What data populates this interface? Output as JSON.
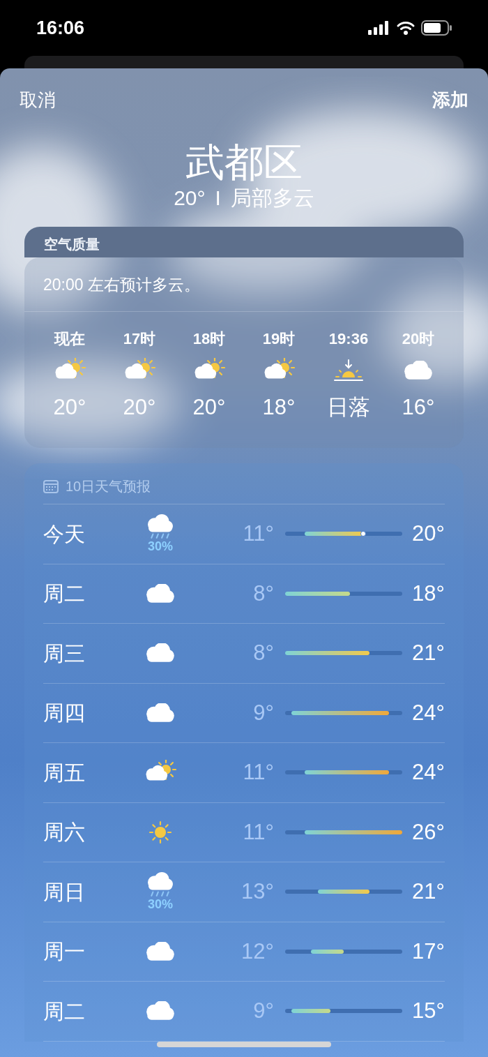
{
  "status_bar": {
    "time": "16:06"
  },
  "nav": {
    "cancel": "取消",
    "add": "添加"
  },
  "location": {
    "name": "武都区",
    "temperature": "20°",
    "separator": "I",
    "condition": "局部多云"
  },
  "air_quality": {
    "label": "空气质量"
  },
  "hourly": {
    "summary": "20:00 左右预计多云。",
    "items": [
      {
        "label": "现在",
        "kind": "partly_sunny",
        "value": "20°"
      },
      {
        "label": "17时",
        "kind": "partly_sunny",
        "value": "20°"
      },
      {
        "label": "18时",
        "kind": "partly_sunny",
        "value": "20°"
      },
      {
        "label": "19时",
        "kind": "partly_sunny",
        "value": "18°"
      },
      {
        "label": "19:36",
        "kind": "sunset",
        "value": "日落"
      },
      {
        "label": "20时",
        "kind": "cloudy",
        "value": "16°"
      }
    ]
  },
  "daily": {
    "title": "10日天气预报",
    "days": [
      {
        "day": "今天",
        "kind": "rain",
        "precipitation": "30%",
        "low": "11°",
        "high": "20°",
        "current": true
      },
      {
        "day": "周二",
        "kind": "cloudy",
        "low": "8°",
        "high": "18°",
        "current": false
      },
      {
        "day": "周三",
        "kind": "cloudy",
        "low": "8°",
        "high": "21°",
        "current": false
      },
      {
        "day": "周四",
        "kind": "cloudy",
        "low": "9°",
        "high": "24°",
        "current": false
      },
      {
        "day": "周五",
        "kind": "partly_sunny",
        "low": "11°",
        "high": "24°",
        "current": false
      },
      {
        "day": "周六",
        "kind": "sunny",
        "low": "11°",
        "high": "26°",
        "current": false
      },
      {
        "day": "周日",
        "kind": "rain",
        "precipitation": "30%",
        "low": "13°",
        "high": "21°",
        "current": false
      },
      {
        "day": "周一",
        "kind": "cloudy",
        "low": "12°",
        "high": "17°",
        "current": false
      },
      {
        "day": "周二",
        "kind": "cloudy",
        "low": "9°",
        "high": "15°",
        "current": false
      }
    ]
  }
}
